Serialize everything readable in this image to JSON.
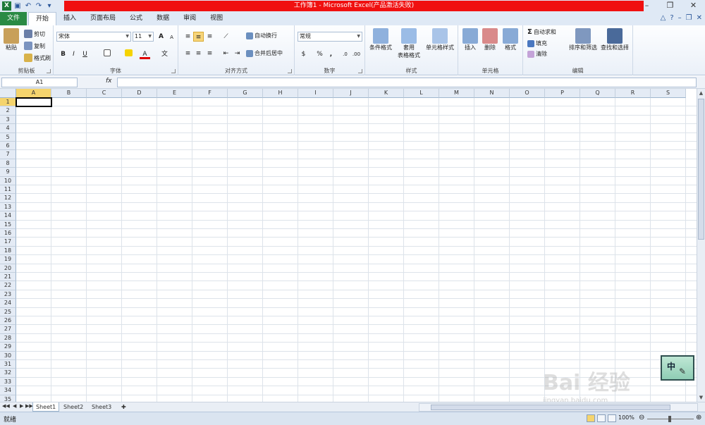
{
  "window": {
    "title": "工作簿1 - Microsoft Excel(产品激活失败)",
    "app_icon": "X",
    "title_color": "#f01010"
  },
  "tabs": [
    {
      "label": "文件"
    },
    {
      "label": "开始"
    },
    {
      "label": "插入"
    },
    {
      "label": "页面布局"
    },
    {
      "label": "公式"
    },
    {
      "label": "数据"
    },
    {
      "label": "审阅"
    },
    {
      "label": "视图"
    }
  ],
  "clipboard": {
    "paste": "粘贴",
    "cut": "剪切",
    "copy": "复制",
    "format_painter": "格式刷",
    "label": "剪贴板"
  },
  "font": {
    "name": "宋体",
    "size": "11",
    "label": "字体",
    "bold": "B",
    "italic": "I",
    "underline": "U"
  },
  "alignment": {
    "wrap": "自动换行",
    "merge": "合并后居中",
    "label": "对齐方式"
  },
  "number": {
    "format": "常规",
    "percent": "%",
    "comma": ",",
    "label": "数字"
  },
  "styles": {
    "conditional": "条件格式",
    "table": "套用\n表格格式",
    "table_l1": "套用",
    "table_l2": "表格格式",
    "cell_styles": "单元格样式",
    "label": "样式"
  },
  "cells": {
    "insert": "插入",
    "delete": "删除",
    "format": "格式",
    "label": "单元格"
  },
  "editing": {
    "autosum": "自动求和",
    "fill": "填充",
    "clear": "清除",
    "sort": "排序和筛选",
    "find": "查找和选择",
    "label": "编辑"
  },
  "formula_bar": {
    "name_box": "A1",
    "fx": "fx",
    "value": ""
  },
  "columns": [
    "A",
    "B",
    "C",
    "D",
    "E",
    "F",
    "G",
    "H",
    "I",
    "J",
    "K",
    "L",
    "M",
    "N",
    "O",
    "P",
    "Q",
    "R",
    "S"
  ],
  "rows": [
    "1",
    "2",
    "3",
    "4",
    "5",
    "6",
    "7",
    "8",
    "9",
    "10",
    "11",
    "12",
    "13",
    "14",
    "15",
    "16",
    "17",
    "18",
    "19",
    "20",
    "21",
    "22",
    "23",
    "24",
    "25",
    "26",
    "27",
    "28",
    "29",
    "30",
    "31",
    "32",
    "33",
    "34",
    "35"
  ],
  "sheets": [
    "Sheet1",
    "Sheet2",
    "Sheet3"
  ],
  "status": {
    "ready": "就绪",
    "zoom": "100%"
  },
  "ime": {
    "label": "中"
  },
  "watermark": {
    "brand": "Bai 经验",
    "url": "jingyan.baidu.com"
  }
}
